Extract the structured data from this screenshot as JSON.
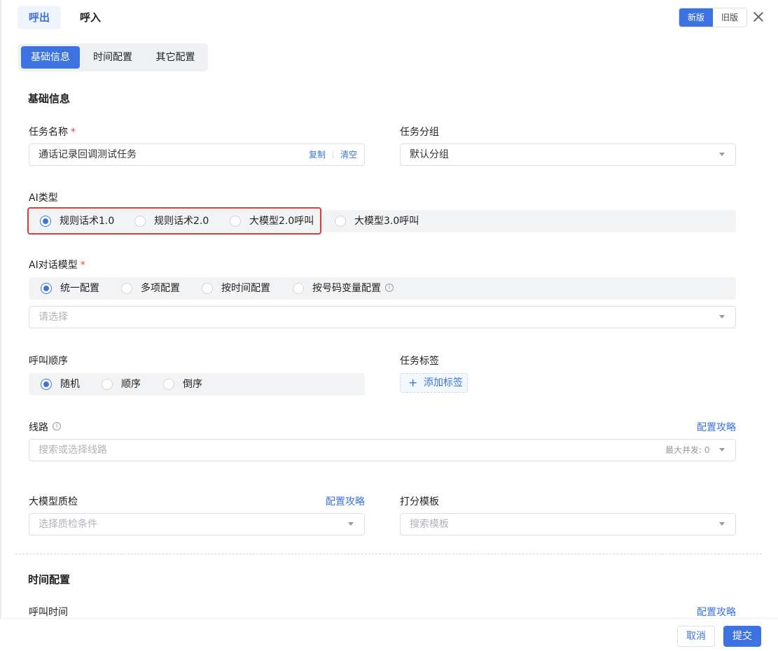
{
  "header": {
    "tabs": [
      {
        "label": "呼出"
      },
      {
        "label": "呼入"
      }
    ],
    "version": {
      "new_label": "新版",
      "old_label": "旧版"
    }
  },
  "subtabs": [
    {
      "label": "基础信息"
    },
    {
      "label": "时间配置"
    },
    {
      "label": "其它配置"
    }
  ],
  "basic": {
    "title": "基础信息",
    "task_name": {
      "label": "任务名称",
      "required": "*",
      "value": "通话记录回调测试任务",
      "copy_label": "复制",
      "clear_label": "清空"
    },
    "task_group": {
      "label": "任务分组",
      "value": "默认分组"
    },
    "ai_type": {
      "label": "AI类型",
      "options": [
        {
          "label": "规则话术1.0"
        },
        {
          "label": "规则话术2.0"
        },
        {
          "label": "大模型2.0呼叫"
        },
        {
          "label": "大模型3.0呼叫"
        }
      ],
      "selected": 0
    },
    "ai_model": {
      "label": "AI对话模型",
      "required": "*",
      "options": [
        {
          "label": "统一配置"
        },
        {
          "label": "多项配置"
        },
        {
          "label": "按时间配置"
        },
        {
          "label": "按号码变量配置"
        }
      ],
      "selected": 0,
      "placeholder": "请选择"
    },
    "call_order": {
      "label": "呼叫顺序",
      "options": [
        {
          "label": "随机"
        },
        {
          "label": "顺序"
        },
        {
          "label": "倒序"
        }
      ],
      "selected": 0
    },
    "task_tags": {
      "label": "任务标签",
      "add_label": "添加标签",
      "plus": "+"
    },
    "line": {
      "label": "线路",
      "guide_label": "配置攻略",
      "placeholder": "搜索或选择线路",
      "max_concurrency": "最大并发: 0"
    },
    "qc": {
      "label": "大模型质检",
      "guide_label": "配置攻略",
      "placeholder": "选择质检条件"
    },
    "score": {
      "label": "打分模板",
      "placeholder": "搜索模板"
    }
  },
  "time_section": {
    "title": "时间配置",
    "call_time": {
      "label": "呼叫时间",
      "guide_label": "配置攻略"
    }
  },
  "footer": {
    "cancel_label": "取消",
    "submit_label": "提交"
  },
  "colors": {
    "accent": "#3c73e0",
    "highlight": "#e53935"
  }
}
